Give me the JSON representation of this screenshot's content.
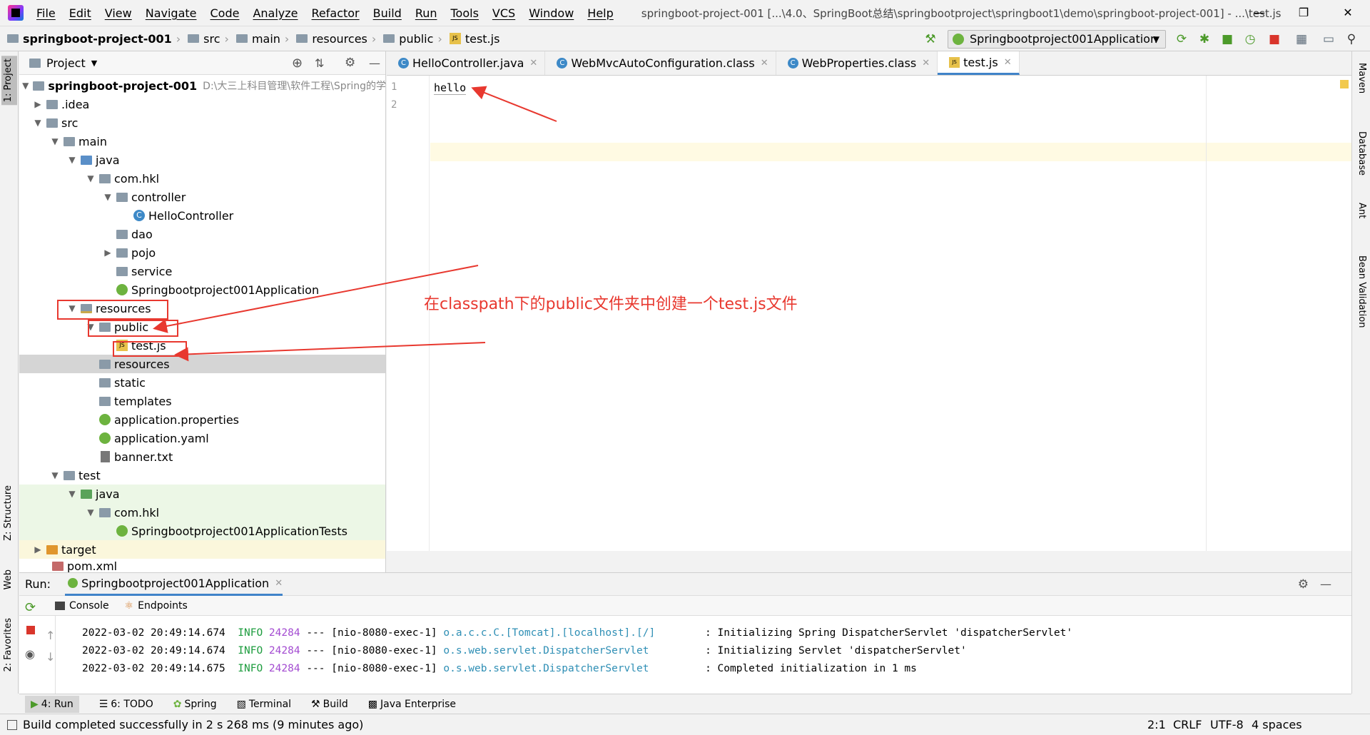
{
  "menu": {
    "items": [
      "File",
      "Edit",
      "View",
      "Navigate",
      "Code",
      "Analyze",
      "Refactor",
      "Build",
      "Run",
      "Tools",
      "VCS",
      "Window",
      "Help"
    ],
    "title": "springboot-project-001 [...\\4.0、SpringBoot总结\\springbootproject\\springboot1\\demo\\springboot-project-001] - ...\\test.js"
  },
  "breadcrumb": [
    "springboot-project-001",
    "src",
    "main",
    "resources",
    "public",
    "test.js"
  ],
  "run_config": "Springbootproject001Application",
  "left_tabs": {
    "project": "1: Project",
    "structure": "Z: Structure",
    "web": "Web",
    "favorites": "2: Favorites"
  },
  "right_tabs": {
    "maven": "Maven",
    "database": "Database",
    "ant": "Ant",
    "bean": "Bean Validation"
  },
  "project": {
    "header": "Project",
    "root_name": "springboot-project-001",
    "root_path": "D:\\大三上科目管理\\软件工程\\Spring的学",
    "nodes": [
      {
        "label": ".idea"
      },
      {
        "label": "src"
      },
      {
        "label": "main"
      },
      {
        "label": "java"
      },
      {
        "label": "com.hkl"
      },
      {
        "label": "controller"
      },
      {
        "label": "HelloController"
      },
      {
        "label": "dao"
      },
      {
        "label": "pojo"
      },
      {
        "label": "service"
      },
      {
        "label": "Springbootproject001Application"
      },
      {
        "label": "resources"
      },
      {
        "label": "public"
      },
      {
        "label": "test.js"
      },
      {
        "label": "resources"
      },
      {
        "label": "static"
      },
      {
        "label": "templates"
      },
      {
        "label": "application.properties"
      },
      {
        "label": "application.yaml"
      },
      {
        "label": "banner.txt"
      },
      {
        "label": "test"
      },
      {
        "label": "java"
      },
      {
        "label": "com.hkl"
      },
      {
        "label": "Springbootproject001ApplicationTests"
      },
      {
        "label": "target"
      },
      {
        "label": "pom.xml"
      }
    ]
  },
  "editor": {
    "tabs": [
      "HelloController.java",
      "WebMvcAutoConfiguration.class",
      "WebProperties.class",
      "test.js"
    ],
    "active_tab": "test.js",
    "lines": [
      "1",
      "2"
    ],
    "code": "hello",
    "annotation": "在classpath下的public文件夹中创建一个test.js文件"
  },
  "run": {
    "label": "Run:",
    "config": "Springbootproject001Application",
    "subtabs": [
      "Console",
      "Endpoints"
    ],
    "logs": [
      {
        "date": "2022-03-02 20:49:14.674",
        "level": "INFO",
        "pid": "24284",
        "sep": "---",
        "thread": "[nio-8080-exec-1]",
        "logger": "o.a.c.c.C.[Tomcat].[localhost].[/]",
        "msg": ": Initializing Spring DispatcherServlet 'dispatcherServlet'"
      },
      {
        "date": "2022-03-02 20:49:14.674",
        "level": "INFO",
        "pid": "24284",
        "sep": "---",
        "thread": "[nio-8080-exec-1]",
        "logger": "o.s.web.servlet.DispatcherServlet",
        "msg": ": Initializing Servlet 'dispatcherServlet'"
      },
      {
        "date": "2022-03-02 20:49:14.675",
        "level": "INFO",
        "pid": "24284",
        "sep": "---",
        "thread": "[nio-8080-exec-1]",
        "logger": "o.s.web.servlet.DispatcherServlet",
        "msg": ": Completed initialization in 1 ms"
      }
    ]
  },
  "bottom_tabs": [
    "4: Run",
    "6: TODO",
    "Spring",
    "Terminal",
    "Build",
    "Java Enterprise"
  ],
  "status": {
    "message": "Build completed successfully in 2 s 268 ms (9 minutes ago)",
    "position": "2:1",
    "line_sep": "CRLF",
    "encoding": "UTF-8",
    "indent": "4 spaces"
  },
  "colors": {
    "accent": "#4083c9",
    "annotation": "#e8382f",
    "info": "#1d9c3e",
    "logger": "#2f8fb5",
    "pid": "#a34bd1"
  }
}
